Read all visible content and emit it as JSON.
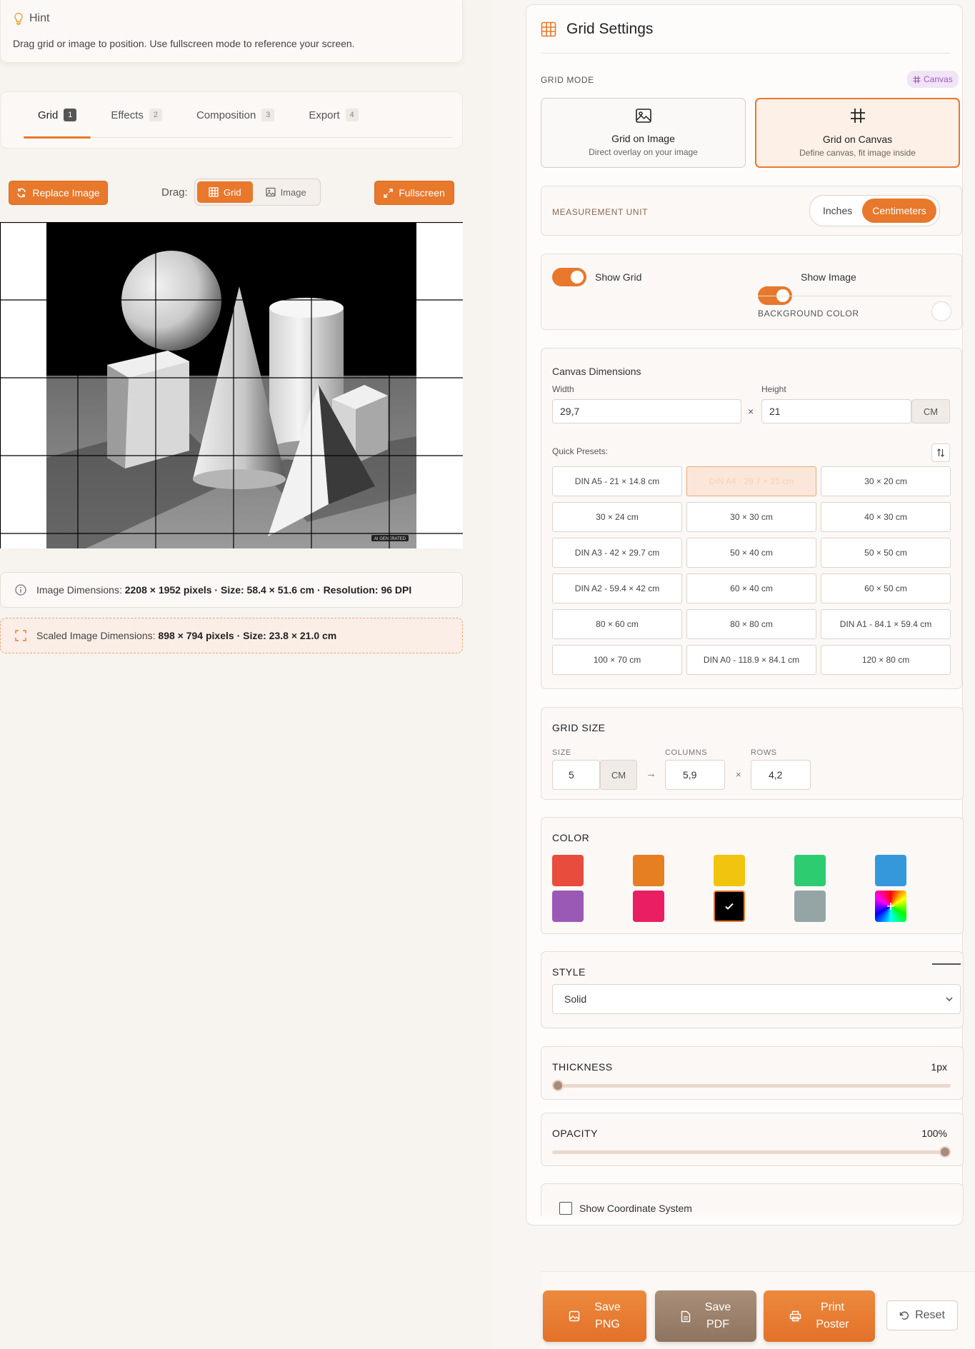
{
  "hint": {
    "title": "Hint",
    "text": "Drag grid or image to position. Use fullscreen mode to reference your screen."
  },
  "tabs": [
    {
      "label": "Grid",
      "num": "1"
    },
    {
      "label": "Effects",
      "num": "2"
    },
    {
      "label": "Composition",
      "num": "3"
    },
    {
      "label": "Export",
      "num": "4"
    }
  ],
  "toolbar": {
    "replace_label": "Replace Image",
    "drag_label": "Drag:",
    "grid_option": "Grid",
    "image_option": "Image",
    "fullscreen_label": "Fullscreen"
  },
  "image_info": {
    "label": "Image Dimensions:",
    "value": "2208 × 1952 pixels · Size: 58.4 × 51.6 cm · Resolution: 96 DPI",
    "scaled_label": "Scaled Image Dimensions:",
    "scaled_value": "898 × 794 pixels · Size: 23.8 × 21.0 cm",
    "watermark": "AI GENERATED"
  },
  "panel": {
    "title": "Grid Settings",
    "grid_mode_label": "GRID MODE",
    "mode_badge": "Canvas",
    "modes": [
      {
        "title": "Grid on Image",
        "subtitle": "Direct overlay on your image"
      },
      {
        "title": "Grid on Canvas",
        "subtitle": "Define canvas, fit image inside"
      }
    ],
    "measurement_label": "MEASUREMENT UNIT",
    "units": [
      "Inches",
      "Centimeters"
    ],
    "show_grid": "Show Grid",
    "show_image": "Show Image",
    "background_color": "BACKGROUND COLOR",
    "canvas_dims_title": "Canvas Dimensions",
    "width_label": "Width",
    "height_label": "Height",
    "width_value": "29,7",
    "height_value": "21",
    "times": "×",
    "unit_cm": "CM",
    "quick_presets": "Quick Presets:",
    "presets": [
      "DIN A5 - 21 × 14.8 cm",
      "DIN A4 - 29.7 × 21 cm",
      "30 × 20 cm",
      "30 × 24 cm",
      "30 × 30 cm",
      "40 × 30 cm",
      "DIN A3 - 42 × 29.7 cm",
      "50 × 40 cm",
      "50 × 50 cm",
      "DIN A2 - 59.4 × 42 cm",
      "60 × 40 cm",
      "60 × 50 cm",
      "80 × 60 cm",
      "80 × 80 cm",
      "DIN A1 - 84.1 × 59.4 cm",
      "100 × 70 cm",
      "DIN A0 - 118.9 × 84.1 cm",
      "120 × 80 cm"
    ],
    "grid_size_title": "GRID SIZE",
    "size_label": "SIZE",
    "columns_label": "COLUMNS",
    "rows_label": "ROWS",
    "size_value": "5",
    "size_unit": "CM",
    "arrow": "→",
    "columns_value": "5,9",
    "rows_value": "4,2",
    "color_title": "COLOR",
    "colors": [
      "#e74c3c",
      "#e67e22",
      "#f1c40f",
      "#2ecc71",
      "#3498db",
      "#9b59b6",
      "#e91e63",
      "#000000",
      "#95a5a6"
    ],
    "style_title": "STYLE",
    "style_value": "Solid",
    "thickness_title": "THICKNESS",
    "thickness_value": "1px",
    "thickness_level": 0,
    "opacity_title": "OPACITY",
    "opacity_value": "100%",
    "opacity_level": 1,
    "coord_label": "Show Coordinate System"
  },
  "footer": {
    "save_png": [
      "Save",
      "PNG"
    ],
    "save_pdf": [
      "Save",
      "PDF"
    ],
    "print_poster": [
      "Print",
      "Poster"
    ],
    "reset": "Reset"
  }
}
